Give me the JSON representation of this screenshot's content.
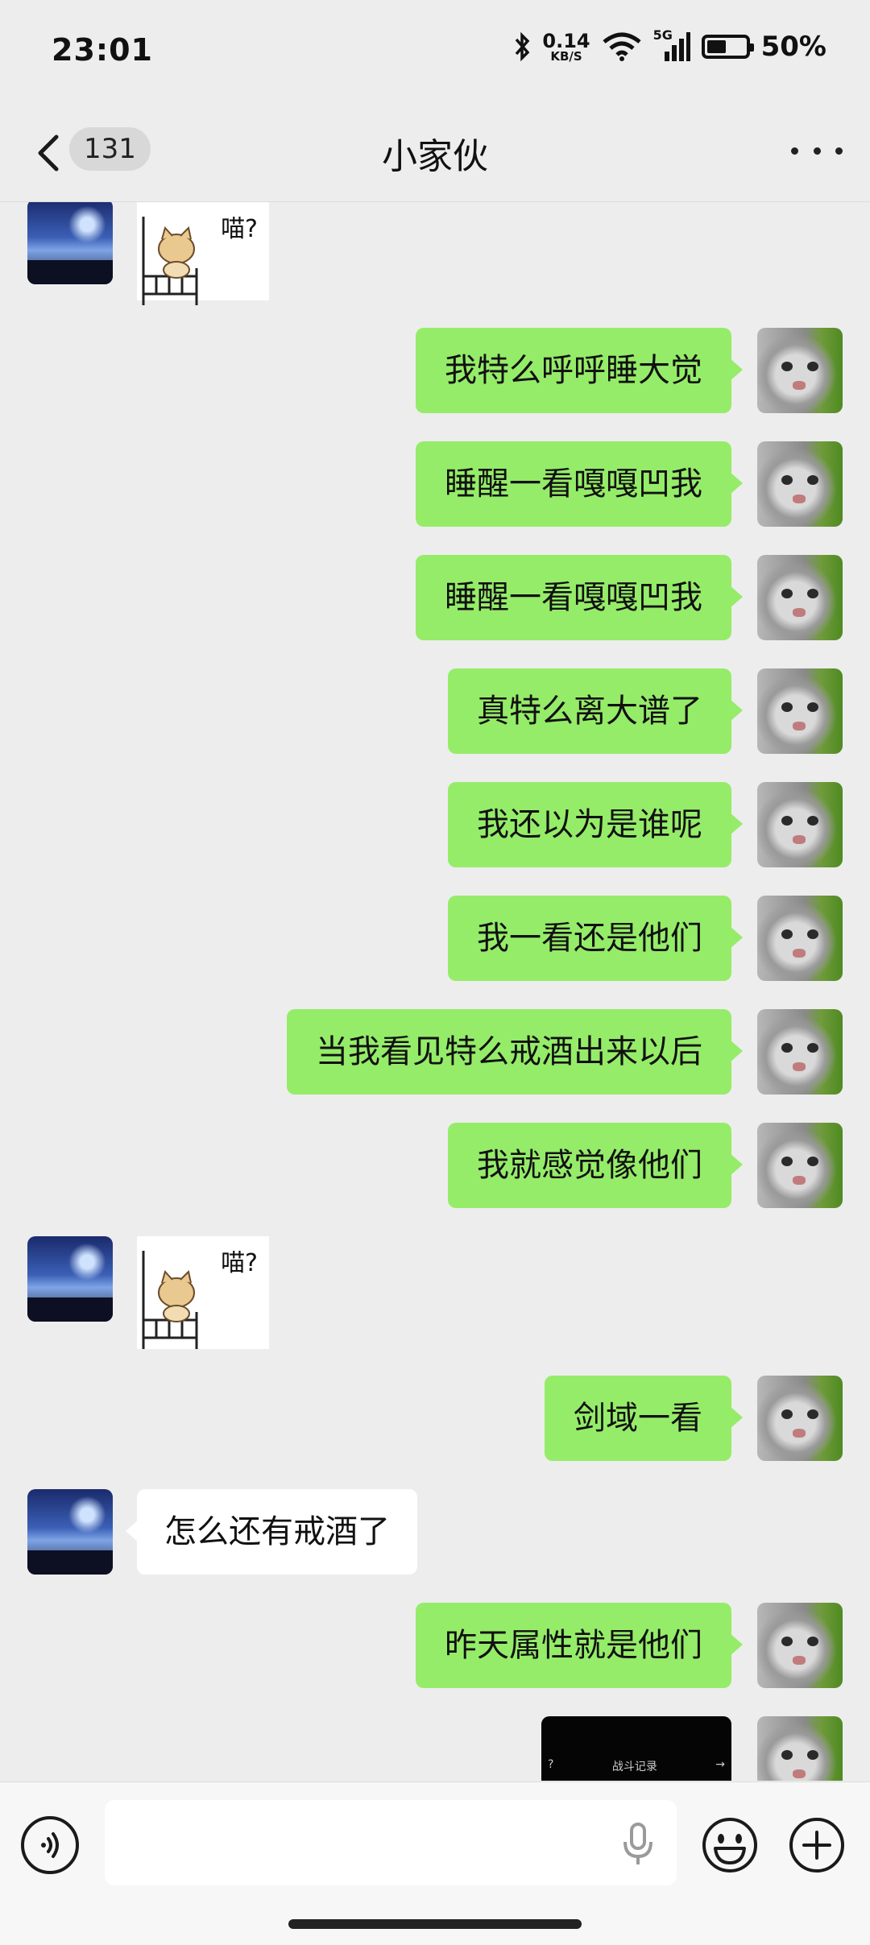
{
  "status_bar": {
    "time": "23:01",
    "net_speed_value": "0.14",
    "net_speed_unit": "KB/S",
    "network": "5G",
    "battery": "50%",
    "battery_level": 0.5,
    "icons": [
      "bluetooth-icon",
      "wifi-icon",
      "signal-icon",
      "battery-icon"
    ]
  },
  "nav": {
    "unread_count": "131",
    "title": "小家伙"
  },
  "messages": [
    {
      "side": "in",
      "type": "sticker",
      "text": "喵?"
    },
    {
      "side": "out",
      "type": "text",
      "text": "我特么呼呼睡大觉"
    },
    {
      "side": "out",
      "type": "text",
      "text": "睡醒一看嘎嘎凹我"
    },
    {
      "side": "out",
      "type": "text",
      "text": "睡醒一看嘎嘎凹我"
    },
    {
      "side": "out",
      "type": "text",
      "text": "真特么离大谱了"
    },
    {
      "side": "out",
      "type": "text",
      "text": "我还以为是谁呢"
    },
    {
      "side": "out",
      "type": "text",
      "text": "我一看还是他们"
    },
    {
      "side": "out",
      "type": "text",
      "text": "当我看见特么戒酒出来以后"
    },
    {
      "side": "out",
      "type": "text",
      "text": "我就感觉像他们"
    },
    {
      "side": "in",
      "type": "sticker",
      "text": "喵?"
    },
    {
      "side": "out",
      "type": "text",
      "text": "剑域一看"
    },
    {
      "side": "in",
      "type": "text",
      "text": "怎么还有戒酒了"
    },
    {
      "side": "out",
      "type": "text",
      "text": "昨天属性就是他们"
    },
    {
      "side": "out",
      "type": "image",
      "text": "战斗记录"
    }
  ],
  "colors": {
    "background": "#ededed",
    "outgoing_bubble": "#95ec69",
    "incoming_bubble": "#ffffff"
  }
}
